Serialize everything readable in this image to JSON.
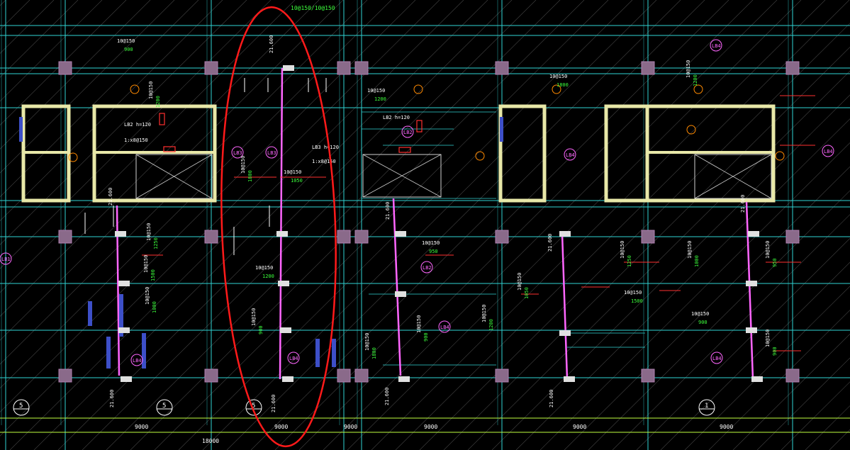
{
  "colors": {
    "background": "#000000",
    "grid": "#2fd3d3",
    "column": "#8a6a8a",
    "wall": "#e8e8a8",
    "beam": "#ff66ff",
    "dim": "#c0ff40",
    "rebar": "#ffffff",
    "label_green": "#3cff3c",
    "label_pink": "#ff66ff",
    "label_orange": "#ff8a00",
    "highlight": "#ff1a1a",
    "hatch": "#3d4fc8"
  },
  "slab_tags": [
    "LB1",
    "LB2",
    "LB3",
    "LB3",
    "LB2",
    "LB4",
    "LB4",
    "LB4",
    "LB4",
    "LB4",
    "LB4",
    "LB4"
  ],
  "bar_labels": [
    "10@150",
    "10@150",
    "10@150",
    "10@150",
    "10@150",
    "10@150",
    "10@150",
    "10@150",
    "10@150",
    "10@150",
    "10@150",
    "10@150"
  ],
  "bar_lengths": [
    "900",
    "1200",
    "1800",
    "1050",
    "1250",
    "1500",
    "1200",
    "1000",
    "900",
    "950"
  ],
  "beam_notes": [
    "LB2 h=120",
    "1:x8@150",
    "LB3 h=120",
    "1:x8@150",
    "LB2 h=120"
  ],
  "dims": {
    "bay": "9000",
    "total": "18000",
    "small": "9000",
    "elev": "21.600"
  },
  "axis_bubbles": [
    "5",
    "5",
    "5",
    "1"
  ],
  "top_note": "10@150/10@150"
}
